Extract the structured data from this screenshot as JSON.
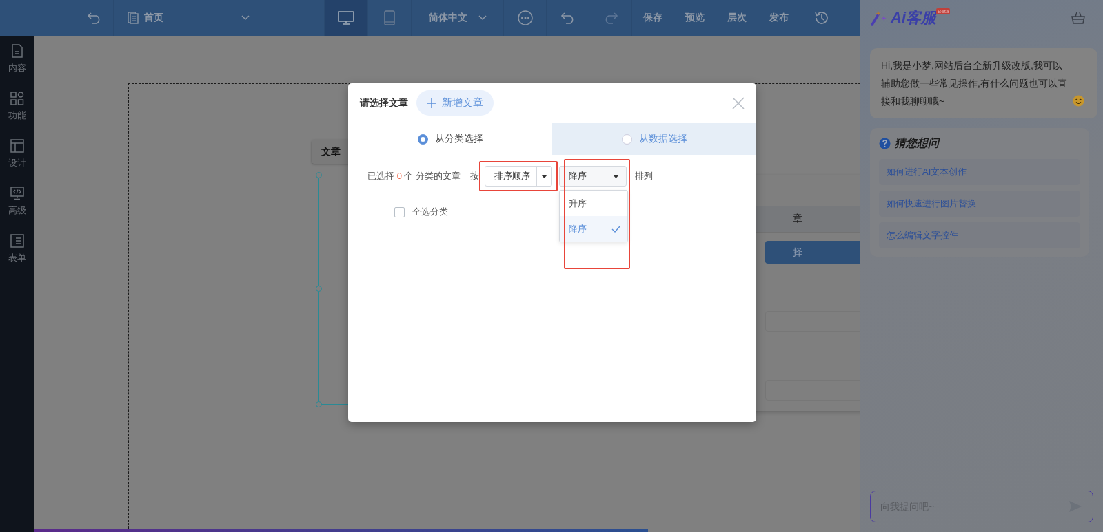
{
  "toolbar": {
    "page": "首页",
    "devices": [
      {
        "kind": "desktop",
        "selected": true
      },
      {
        "kind": "tablet",
        "selected": false
      }
    ],
    "language": "简体中文",
    "actions": [
      {
        "label": "保存"
      },
      {
        "label": "预览"
      },
      {
        "label": "层次"
      },
      {
        "label": "发布"
      }
    ]
  },
  "sidebar": {
    "items": [
      {
        "label": "内容"
      },
      {
        "label": "功能"
      },
      {
        "label": "设计"
      },
      {
        "label": "高级"
      },
      {
        "label": "表单"
      }
    ]
  },
  "canvas": {
    "widget_tag": "文章"
  },
  "background_panel": {
    "tab_fragment": "章",
    "button_fragment": "择"
  },
  "dialog": {
    "title": "请选择文章",
    "add_button": "新增文章",
    "tabs": [
      {
        "label": "从分类选择",
        "selected": true
      },
      {
        "label": "从数据选择",
        "selected": false
      }
    ],
    "summary": {
      "prefix": "已选择",
      "count": "0",
      "suffix": "个 分类的文章"
    },
    "by_label": "按",
    "sort_field": {
      "value": "排序顺序",
      "highlighted": true
    },
    "sort_order": {
      "value": "降序",
      "highlighted": true,
      "expanded": true,
      "options": [
        {
          "label": "升序",
          "selected": false
        },
        {
          "label": "降序",
          "selected": true
        }
      ]
    },
    "after_label": "排列",
    "select_all": {
      "label": "全选分类",
      "checked": false
    }
  },
  "assistant": {
    "title": "Ai客服",
    "badge": "Beta",
    "greeting": "Hi,我是小梦,网站后台全新升级改版,我可以辅助您做一些常见操作,有什么问题也可以直接和我聊聊哦~",
    "suggestions_title": "猜您想问",
    "suggestions": [
      "如何进行AI文本创作",
      "如何快速进行图片替换",
      "怎么编辑文字控件"
    ],
    "input": {
      "placeholder": "向我提问吧~"
    }
  }
}
